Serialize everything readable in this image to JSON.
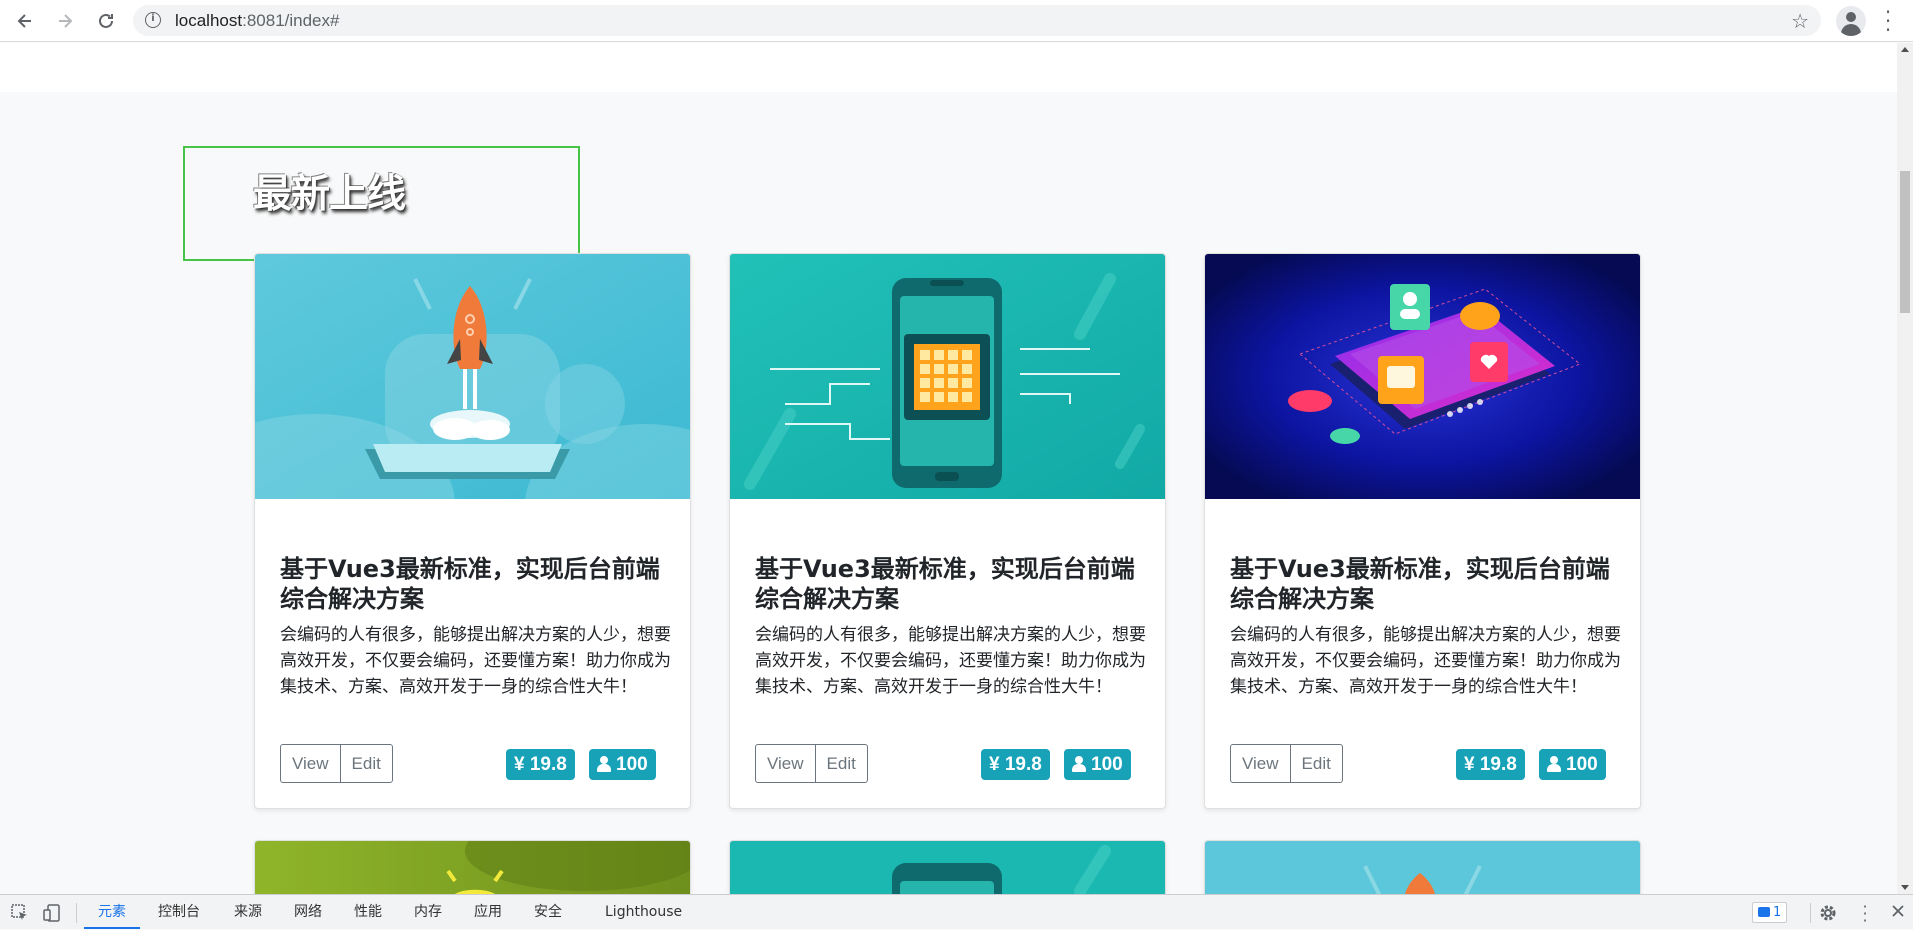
{
  "browser": {
    "url_host": "localhost",
    "url_rest": ":8081/index#",
    "back_icon": "arrow-back-icon",
    "forward_icon": "arrow-forward-icon",
    "reload_icon": "reload-icon"
  },
  "section": {
    "title": "最新上线"
  },
  "cards": [
    {
      "title": "基于Vue3最新标准，实现后台前端综合解决方案",
      "text": "会编码的人有很多，能够提出解决方案的人少，想要高效开发，不仅要会编码，还要懂方案！助力你成为集技术、方案、高效开发于一身的综合性大牛！",
      "view_label": "View",
      "edit_label": "Edit",
      "price": "¥ 19.8",
      "users": "100",
      "image": "rocket-illustration"
    },
    {
      "title": "基于Vue3最新标准，实现后台前端综合解决方案",
      "text": "会编码的人有很多，能够提出解决方案的人少，想要高效开发，不仅要会编码，还要懂方案！助力你成为集技术、方案、高效开发于一身的综合性大牛！",
      "view_label": "View",
      "edit_label": "Edit",
      "price": "¥ 19.8",
      "users": "100",
      "image": "phone-chip-illustration"
    },
    {
      "title": "基于Vue3最新标准，实现后台前端综合解决方案",
      "text": "会编码的人有很多，能够提出解决方案的人少，想要高效开发，不仅要会编码，还要懂方案！助力你成为集技术、方案、高效开发于一身的综合性大牛！",
      "view_label": "View",
      "edit_label": "Edit",
      "price": "¥ 19.8",
      "users": "100",
      "image": "isometric-phone-illustration"
    }
  ],
  "devtools": {
    "tabs": [
      "元素",
      "控制台",
      "来源",
      "网络",
      "性能",
      "内存",
      "应用",
      "安全",
      "Lighthouse"
    ],
    "active_tab": "元素",
    "issues_count": "1"
  },
  "colors": {
    "badge": "#17a2b8",
    "highlight_border": "#47c447",
    "page_bg": "#f8f9fa"
  }
}
